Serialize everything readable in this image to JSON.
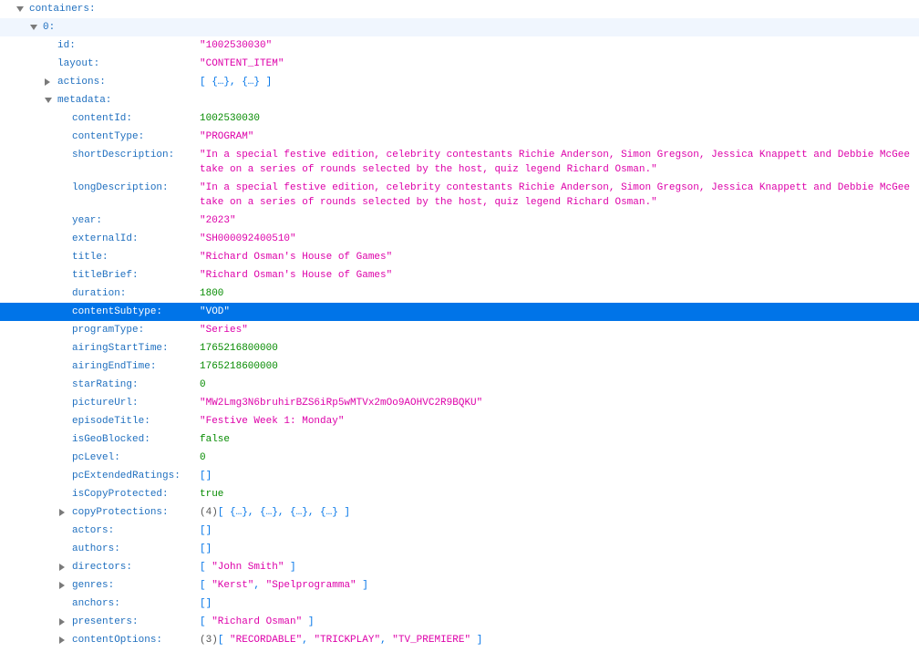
{
  "colors": {
    "key": "#1f6fbf",
    "string": "#dd00a9",
    "number": "#058b00",
    "punct": "#0074e8",
    "selected_bg": "#0074e8"
  },
  "rows": [
    {
      "key": "containers:",
      "depth": 0,
      "arrow": "open",
      "value": []
    },
    {
      "key": "0:",
      "depth": 1,
      "arrow": "open",
      "hover": true,
      "value": []
    },
    {
      "key": "id:",
      "depth": 2,
      "value": [
        {
          "t": "\"1002530030\"",
          "c": "s"
        }
      ]
    },
    {
      "key": "layout:",
      "depth": 2,
      "value": [
        {
          "t": "\"CONTENT_ITEM\"",
          "c": "s"
        }
      ]
    },
    {
      "key": "actions:",
      "depth": 2,
      "arrow": "closed",
      "value": [
        {
          "t": "[ {…}, {…} ]",
          "c": "p"
        }
      ]
    },
    {
      "key": "metadata:",
      "depth": 2,
      "arrow": "open",
      "value": []
    },
    {
      "key": "contentId:",
      "depth": 3,
      "value": [
        {
          "t": "1002530030",
          "c": "n"
        }
      ]
    },
    {
      "key": "contentType:",
      "depth": 3,
      "value": [
        {
          "t": "\"PROGRAM\"",
          "c": "s"
        }
      ]
    },
    {
      "key": "shortDescription:",
      "depth": 3,
      "value": [
        {
          "t": "\"In a special festive edition, celebrity contestants Richie Anderson, Simon Gregson, Jessica Knappett and Debbie McGee take on a series of rounds selected by the host, quiz legend Richard Osman.\"",
          "c": "s"
        }
      ]
    },
    {
      "key": "longDescription:",
      "depth": 3,
      "value": [
        {
          "t": "\"In a special festive edition, celebrity contestants Richie Anderson, Simon Gregson, Jessica Knappett and Debbie McGee take on a series of rounds selected by the host, quiz legend Richard Osman.\"",
          "c": "s"
        }
      ]
    },
    {
      "key": "year:",
      "depth": 3,
      "value": [
        {
          "t": "\"2023\"",
          "c": "s"
        }
      ]
    },
    {
      "key": "externalId:",
      "depth": 3,
      "value": [
        {
          "t": "\"SH000092400510\"",
          "c": "s"
        }
      ]
    },
    {
      "key": "title:",
      "depth": 3,
      "value": [
        {
          "t": "\"Richard Osman's House of Games\"",
          "c": "s"
        }
      ]
    },
    {
      "key": "titleBrief:",
      "depth": 3,
      "value": [
        {
          "t": "\"Richard Osman's House of Games\"",
          "c": "s"
        }
      ]
    },
    {
      "key": "duration:",
      "depth": 3,
      "value": [
        {
          "t": "1800",
          "c": "n"
        }
      ]
    },
    {
      "key": "contentSubtype:",
      "depth": 3,
      "selected": true,
      "value": [
        {
          "t": "\"VOD\"",
          "c": "s"
        }
      ]
    },
    {
      "key": "programType:",
      "depth": 3,
      "value": [
        {
          "t": "\"Series\"",
          "c": "s"
        }
      ]
    },
    {
      "key": "airingStartTime:",
      "depth": 3,
      "value": [
        {
          "t": "1765216800000",
          "c": "n"
        }
      ]
    },
    {
      "key": "airingEndTime:",
      "depth": 3,
      "value": [
        {
          "t": "1765218600000",
          "c": "n"
        }
      ]
    },
    {
      "key": "starRating:",
      "depth": 3,
      "value": [
        {
          "t": "0",
          "c": "n"
        }
      ]
    },
    {
      "key": "pictureUrl:",
      "depth": 3,
      "value": [
        {
          "t": "\"MW2Lmg3N6bruhirBZS6iRp5wMTVx2mOo9AOHVC2R9BQKU\"",
          "c": "s"
        }
      ]
    },
    {
      "key": "episodeTitle:",
      "depth": 3,
      "value": [
        {
          "t": "\"Festive Week 1: Monday\"",
          "c": "s"
        }
      ]
    },
    {
      "key": "isGeoBlocked:",
      "depth": 3,
      "value": [
        {
          "t": "false",
          "c": "n"
        }
      ]
    },
    {
      "key": "pcLevel:",
      "depth": 3,
      "value": [
        {
          "t": "0",
          "c": "n"
        }
      ]
    },
    {
      "key": "pcExtendedRatings:",
      "depth": 3,
      "value": [
        {
          "t": "[]",
          "c": "p"
        }
      ]
    },
    {
      "key": "isCopyProtected:",
      "depth": 3,
      "value": [
        {
          "t": "true",
          "c": "n"
        }
      ]
    },
    {
      "key": "copyProtections:",
      "depth": 3,
      "arrow": "closed",
      "value": [
        {
          "t": "(4)",
          "c": "c"
        },
        {
          "t": "[ {…}, {…}, {…}, {…} ]",
          "c": "p"
        }
      ]
    },
    {
      "key": "actors:",
      "depth": 3,
      "value": [
        {
          "t": "[]",
          "c": "p"
        }
      ]
    },
    {
      "key": "authors:",
      "depth": 3,
      "value": [
        {
          "t": "[]",
          "c": "p"
        }
      ]
    },
    {
      "key": "directors:",
      "depth": 3,
      "arrow": "closed",
      "value": [
        {
          "t": "[ ",
          "c": "p"
        },
        {
          "t": "\"John Smith\"",
          "c": "s"
        },
        {
          "t": " ]",
          "c": "p"
        }
      ]
    },
    {
      "key": "genres:",
      "depth": 3,
      "arrow": "closed",
      "value": [
        {
          "t": "[ ",
          "c": "p"
        },
        {
          "t": "\"Kerst\"",
          "c": "s"
        },
        {
          "t": ", ",
          "c": "p"
        },
        {
          "t": "\"Spelprogramma\"",
          "c": "s"
        },
        {
          "t": " ]",
          "c": "p"
        }
      ]
    },
    {
      "key": "anchors:",
      "depth": 3,
      "value": [
        {
          "t": "[]",
          "c": "p"
        }
      ]
    },
    {
      "key": "presenters:",
      "depth": 3,
      "arrow": "closed",
      "value": [
        {
          "t": "[ ",
          "c": "p"
        },
        {
          "t": "\"Richard Osman\"",
          "c": "s"
        },
        {
          "t": " ]",
          "c": "p"
        }
      ]
    },
    {
      "key": "contentOptions:",
      "depth": 3,
      "arrow": "closed",
      "value": [
        {
          "t": "(3)",
          "c": "c"
        },
        {
          "t": "[ ",
          "c": "p"
        },
        {
          "t": "\"RECORDABLE\"",
          "c": "s"
        },
        {
          "t": ", ",
          "c": "p"
        },
        {
          "t": "\"TRICKPLAY\"",
          "c": "s"
        },
        {
          "t": ", ",
          "c": "p"
        },
        {
          "t": "\"TV_PREMIERE\"",
          "c": "s"
        },
        {
          "t": " ]",
          "c": "p"
        }
      ]
    }
  ]
}
